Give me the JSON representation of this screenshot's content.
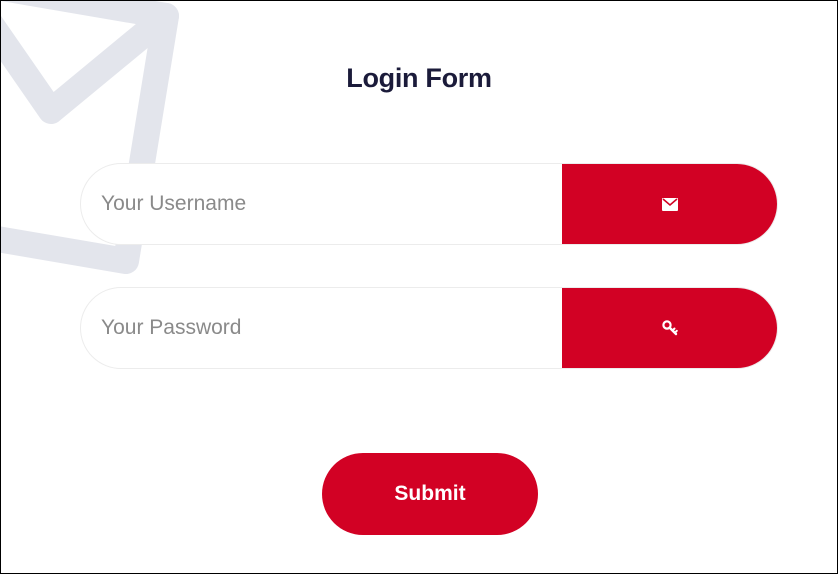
{
  "form": {
    "title": "Login Form",
    "username": {
      "placeholder": "Your Username",
      "value": "",
      "icon": "envelope-icon"
    },
    "password": {
      "placeholder": "Your Password",
      "value": "",
      "icon": "key-icon"
    },
    "submit_label": "Submit"
  },
  "colors": {
    "accent": "#d20124",
    "title": "#1b1b3a",
    "placeholder": "#8a8a8a",
    "background_envelope": "#e3e5ec"
  }
}
